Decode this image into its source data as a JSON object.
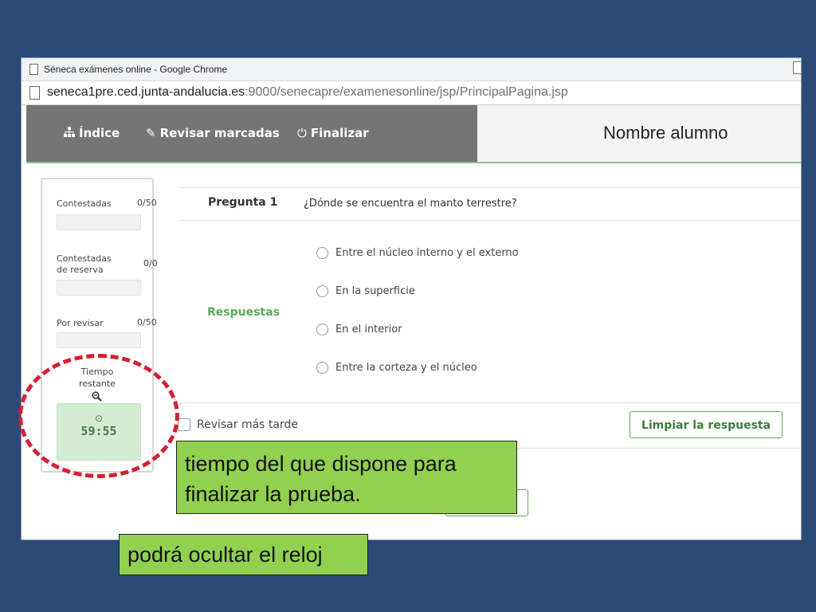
{
  "window": {
    "title": "Séneca exámenes online - Google Chrome",
    "url_host": "seneca1pre.ced.junta-andalucia.es",
    "url_path": ":9000/senecapre/examenesonline/jsp/PrincipalPagina.jsp"
  },
  "nav": {
    "indice": "Índice",
    "revisar_marcadas": "Revisar marcadas",
    "finalizar": "Finalizar",
    "student_name": "Nombre alumno"
  },
  "stats": {
    "contestadas_label": "Contestadas",
    "contestadas_value": "0/50",
    "reserva_label_1": "Contestadas",
    "reserva_label_2": "de reserva",
    "reserva_value": "0/0",
    "revisar_label": "Por revisar",
    "revisar_value": "0/50",
    "tiempo_label_1": "Tiempo",
    "tiempo_label_2": "restante",
    "time": "59:55"
  },
  "question": {
    "number_label": "Pregunta 1",
    "text": "¿Dónde se encuentra el manto terrestre?",
    "answers_label": "Respuestas",
    "options": [
      "Entre el núcleo interno y el externo",
      "En la superficie",
      "En el interior",
      "Entre la corteza y el núcleo"
    ],
    "review_later": "Revisar más tarde",
    "clear_button": "Limpiar la respuesta"
  },
  "annotations": {
    "callout_time_1": "tiempo del que dispone para",
    "callout_time_2": "finalizar la prueba.",
    "callout_clock": "podrá ocultar el reloj"
  },
  "colors": {
    "slide_background": "#2b4a78",
    "nav_background": "#757575",
    "accent_green": "#5aab58",
    "callout_green": "#92d050",
    "dashed_circle": "#d42030"
  }
}
